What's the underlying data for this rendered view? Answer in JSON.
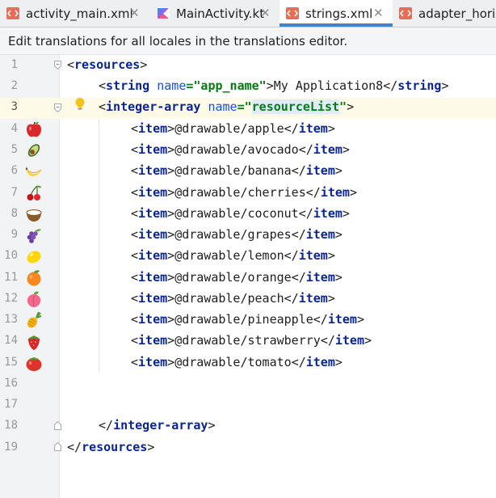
{
  "tabs": [
    {
      "label": "activity_main.xml",
      "icon": "xml-file-icon",
      "active": false
    },
    {
      "label": "MainActivity.kt",
      "icon": "kotlin-file-icon",
      "active": false
    },
    {
      "label": "strings.xml",
      "icon": "xml-file-icon",
      "active": true
    },
    {
      "label": "adapter_horiz",
      "icon": "xml-file-icon",
      "active": false
    }
  ],
  "close_glyph": "✕",
  "banner": {
    "text": "Edit translations for all locales in the translations editor."
  },
  "editor": {
    "line_numbers": [
      "1",
      "2",
      "3",
      "4",
      "5",
      "6",
      "7",
      "8",
      "9",
      "10",
      "11",
      "12",
      "13",
      "14",
      "15",
      "16",
      "17",
      "18",
      "19"
    ],
    "current_line": "3",
    "line1": {
      "open": "<",
      "tag": "resources",
      "close": ">"
    },
    "line2": {
      "open": "<",
      "tag": "string",
      "attr_name": "name",
      "eq": "=",
      "attr_value": "\"app_name\"",
      "gt": ">",
      "text": "My Application8",
      "close_open": "</",
      "close_tag": "string",
      "close_gt": ">"
    },
    "line3": {
      "open": "<",
      "tag": "integer-array",
      "attr_name": "name",
      "eq": "=",
      "quote_open": "\"",
      "attr_value": "resourceList",
      "quote_close": "\"",
      "gt": ">"
    },
    "items": [
      {
        "value": "@drawable/apple",
        "icon": "apple-icon"
      },
      {
        "value": "@drawable/avocado",
        "icon": "avocado-icon"
      },
      {
        "value": "@drawable/banana",
        "icon": "banana-icon"
      },
      {
        "value": "@drawable/cherries",
        "icon": "cherries-icon"
      },
      {
        "value": "@drawable/coconut",
        "icon": "coconut-icon"
      },
      {
        "value": "@drawable/grapes",
        "icon": "grapes-icon"
      },
      {
        "value": "@drawable/lemon",
        "icon": "lemon-icon"
      },
      {
        "value": "@drawable/orange",
        "icon": "orange-icon"
      },
      {
        "value": "@drawable/peach",
        "icon": "peach-icon"
      },
      {
        "value": "@drawable/pineapple",
        "icon": "pineapple-icon"
      },
      {
        "value": "@drawable/strawberry",
        "icon": "strawberry-icon"
      },
      {
        "value": "@drawable/tomato",
        "icon": "tomato-icon"
      }
    ],
    "item_tag": "item",
    "lt": "<",
    "gt": ">",
    "close_lt": "</",
    "line18": {
      "open": "</",
      "tag": "integer-array",
      "close": ">"
    },
    "line19": {
      "open": "</",
      "tag": "resources",
      "close": ">"
    }
  },
  "colors": {
    "tag": "#0a2592",
    "attr_name": "#1750eb",
    "attr_value": "#057b14",
    "active_tab_underline": "#4083c9",
    "current_line": "#fdfbe7"
  }
}
